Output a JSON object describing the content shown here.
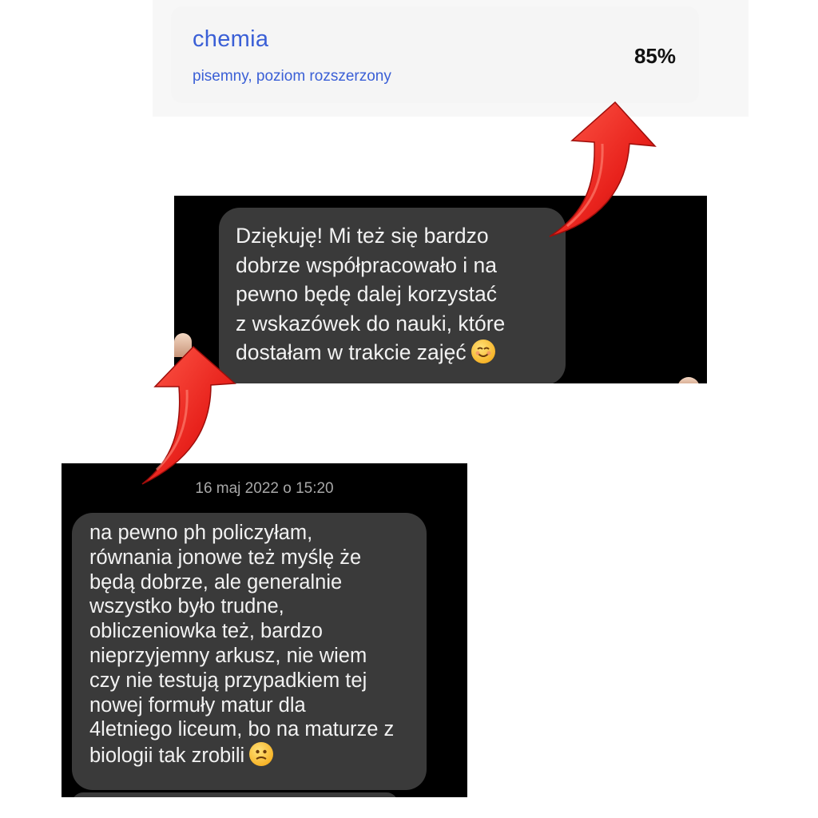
{
  "result_card": {
    "subject": "chemia",
    "exam_level": "pisemny, poziom rozszerzony",
    "score": "85%"
  },
  "chat_top": {
    "message_lines": [
      "Dziękuję! Mi też się bardzo",
      "dobrze współpracowało i na",
      "pewno będę dalej korzystać",
      "z wskazówek do nauki, które",
      "dostałam w trakcie zajęć"
    ],
    "emoji": "smiling-face-icon"
  },
  "chat_bottom": {
    "timestamp": "16 maj 2022 o 15:20",
    "message_lines": [
      "na pewno ph policzyłam,",
      "równania jonowe też myślę że",
      "będą dobrze, ale generalnie",
      "wszystko było trudne,",
      "obliczeniowka też, bardzo",
      "nieprzyjemny arkusz, nie wiem",
      "czy nie testują przypadkiem tej",
      "nowej formuły matur dla",
      "4letniego liceum, bo na maturze z",
      "biologii tak zrobili"
    ],
    "emoji": "confused-face-icon"
  },
  "colors": {
    "accent_blue": "#3a5fd6",
    "arrow_red": "#e8221c",
    "bubble_gray": "#3a3a3a",
    "chat_background": "#000000"
  },
  "icons": [
    "red-curved-arrow-icon",
    "smiling-face-icon",
    "confused-face-icon"
  ]
}
